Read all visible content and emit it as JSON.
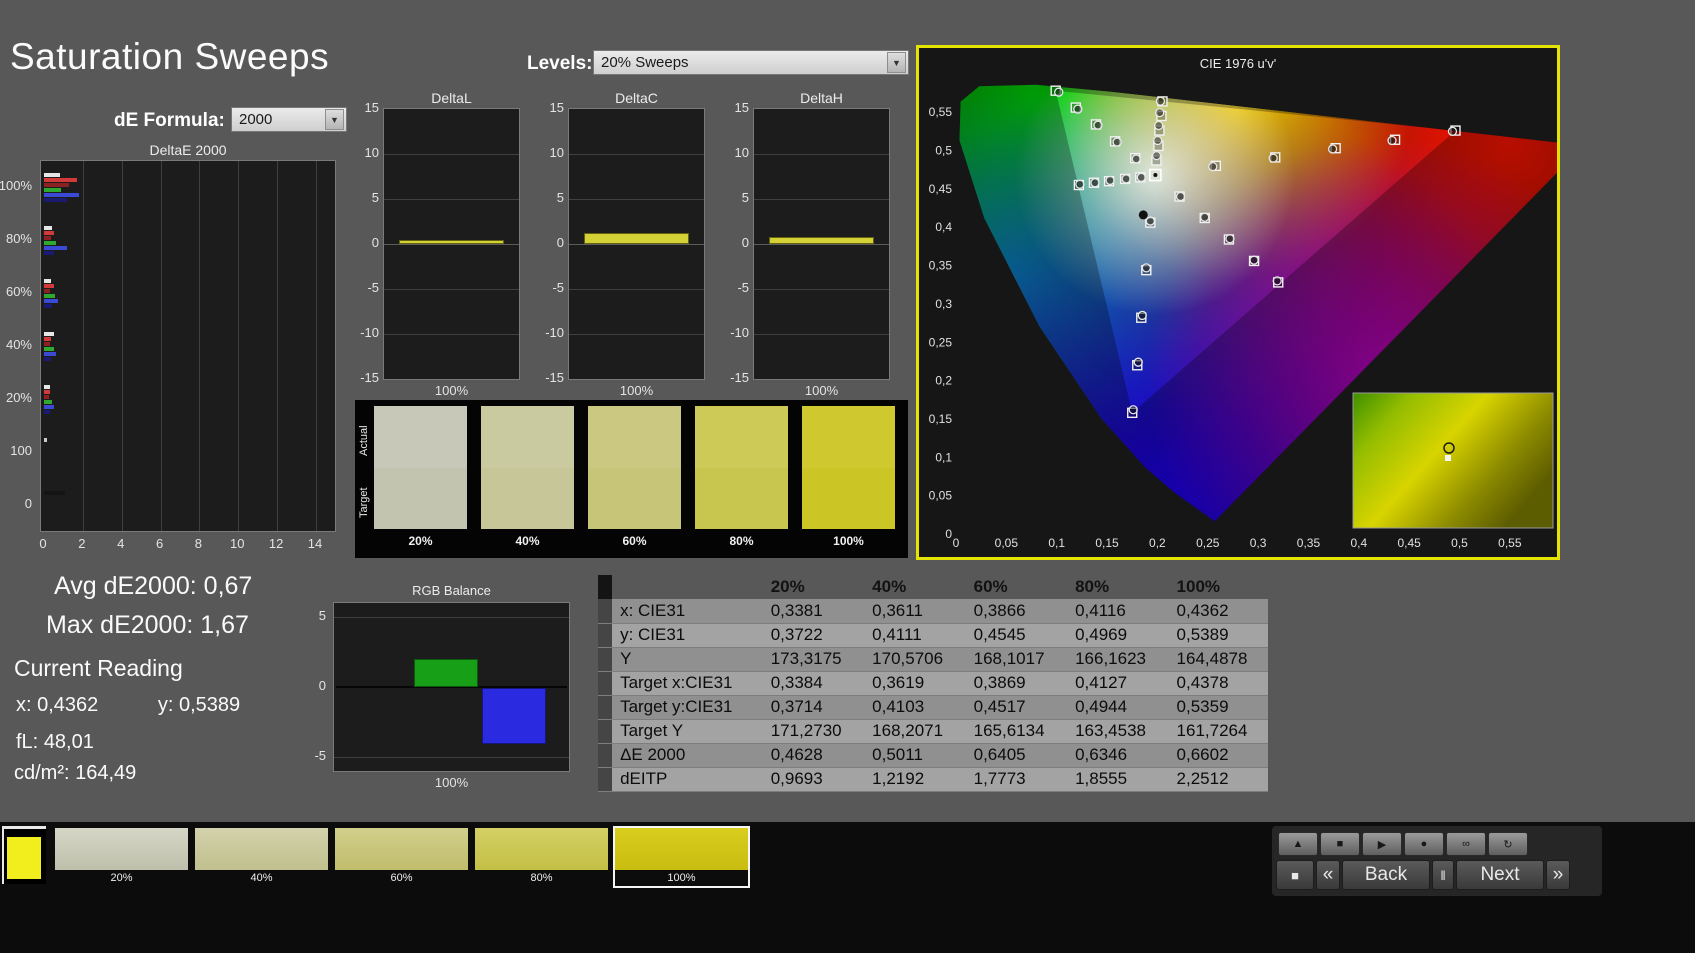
{
  "page": {
    "title": "Saturation Sweeps"
  },
  "controls": {
    "de_formula_label": "dE Formula:",
    "de_formula_value": "2000",
    "levels_label": "Levels:",
    "levels_value": "20% Sweeps"
  },
  "delta_e_chart": {
    "title": "DeltaE 2000",
    "x_ticks": [
      "0",
      "2",
      "4",
      "6",
      "8",
      "10",
      "12",
      "14"
    ],
    "x_max": 14,
    "groups": [
      {
        "label": "100%",
        "bars": [
          {
            "c": "#e6e6e6",
            "v": 0.8
          },
          {
            "c": "#d23a3a",
            "v": 1.7
          },
          {
            "c": "#8d2020",
            "v": 1.3
          },
          {
            "c": "#2fa82f",
            "v": 0.9
          },
          {
            "c": "#3a4ad4",
            "v": 1.8
          },
          {
            "c": "#1a1a70",
            "v": 1.2
          }
        ]
      },
      {
        "label": "80%",
        "bars": [
          {
            "c": "#e6e6e6",
            "v": 0.4
          },
          {
            "c": "#d23a3a",
            "v": 0.5
          },
          {
            "c": "#8d2020",
            "v": 0.35
          },
          {
            "c": "#2fa82f",
            "v": 0.6
          },
          {
            "c": "#3a4ad4",
            "v": 1.2
          },
          {
            "c": "#1a1a70",
            "v": 0.5
          }
        ]
      },
      {
        "label": "60%",
        "bars": [
          {
            "c": "#e6e6e6",
            "v": 0.35
          },
          {
            "c": "#d23a3a",
            "v": 0.5
          },
          {
            "c": "#8d2020",
            "v": 0.3
          },
          {
            "c": "#2fa82f",
            "v": 0.55
          },
          {
            "c": "#3a4ad4",
            "v": 0.7
          },
          {
            "c": "#1a1a70",
            "v": 0.4
          }
        ]
      },
      {
        "label": "40%",
        "bars": [
          {
            "c": "#e6e6e6",
            "v": 0.5
          },
          {
            "c": "#d23a3a",
            "v": 0.35
          },
          {
            "c": "#8d2020",
            "v": 0.3
          },
          {
            "c": "#2fa82f",
            "v": 0.5
          },
          {
            "c": "#3a4ad4",
            "v": 0.6
          },
          {
            "c": "#1a1a70",
            "v": 0.35
          }
        ]
      },
      {
        "label": "20%",
        "bars": [
          {
            "c": "#e6e6e6",
            "v": 0.3
          },
          {
            "c": "#d23a3a",
            "v": 0.3
          },
          {
            "c": "#8d2020",
            "v": 0.25
          },
          {
            "c": "#2fa82f",
            "v": 0.4
          },
          {
            "c": "#3a4ad4",
            "v": 0.5
          },
          {
            "c": "#1a1a70",
            "v": 0.3
          }
        ]
      },
      {
        "label": "100",
        "bars": [
          {
            "c": "#c8c8c8",
            "v": 0.15
          }
        ]
      },
      {
        "label": "0",
        "bars": [
          {
            "c": "#141414",
            "v": 1.1
          }
        ]
      }
    ]
  },
  "delta_chart_axis": {
    "min": -15,
    "max": 15,
    "ticks": [
      15,
      10,
      5,
      0,
      -5,
      -10,
      -15
    ],
    "x_label": "100%"
  },
  "delta_charts": [
    {
      "title": "DeltaL",
      "value": 0.5
    },
    {
      "title": "DeltaC",
      "value": 1.2
    },
    {
      "title": "DeltaH",
      "value": 0.8
    }
  ],
  "swatch_panel": {
    "row_labels": [
      "Actual",
      "Target"
    ],
    "swatches": [
      {
        "label": "20%",
        "actual": "#c7c8b8",
        "target": "#c3c4b0"
      },
      {
        "label": "40%",
        "actual": "#cacaa0",
        "target": "#c6c698"
      },
      {
        "label": "60%",
        "actual": "#cbc981",
        "target": "#c7c578"
      },
      {
        "label": "80%",
        "actual": "#cdca58",
        "target": "#c9c64f"
      },
      {
        "label": "100%",
        "actual": "#cfc92f",
        "target": "#cbc525"
      }
    ]
  },
  "cie_chart": {
    "title": "CIE 1976 u'v'",
    "border_color": "#e4e400",
    "x_ticks": [
      "0",
      "0,05",
      "0,1",
      "0,15",
      "0,2",
      "0,25",
      "0,3",
      "0,35",
      "0,4",
      "0,45",
      "0,5",
      "0,55"
    ],
    "y_ticks": [
      "0,55",
      "0,5",
      "0,45",
      "0,4",
      "0,35",
      "0,3",
      "0,25",
      "0,2",
      "0,15",
      "0,1",
      "0,05",
      "0"
    ],
    "white_point": {
      "u": 0.198,
      "v": 0.468
    },
    "targets": [
      [
        0.258,
        0.48
      ],
      [
        0.317,
        0.491
      ],
      [
        0.377,
        0.503
      ],
      [
        0.436,
        0.514
      ],
      [
        0.496,
        0.526
      ],
      [
        0.178,
        0.49
      ],
      [
        0.158,
        0.512
      ],
      [
        0.139,
        0.534
      ],
      [
        0.119,
        0.556
      ],
      [
        0.099,
        0.578
      ],
      [
        0.193,
        0.406
      ],
      [
        0.189,
        0.344
      ],
      [
        0.184,
        0.282
      ],
      [
        0.18,
        0.22
      ],
      [
        0.175,
        0.158
      ],
      [
        0.183,
        0.465
      ],
      [
        0.168,
        0.463
      ],
      [
        0.152,
        0.46
      ],
      [
        0.137,
        0.458
      ],
      [
        0.122,
        0.455
      ],
      [
        0.222,
        0.44
      ],
      [
        0.247,
        0.412
      ],
      [
        0.271,
        0.384
      ],
      [
        0.296,
        0.356
      ],
      [
        0.32,
        0.328
      ],
      [
        0.199,
        0.487
      ],
      [
        0.201,
        0.506
      ],
      [
        0.202,
        0.526
      ],
      [
        0.204,
        0.545
      ],
      [
        0.205,
        0.564
      ]
    ],
    "measured": [
      [
        0.255,
        0.479
      ],
      [
        0.315,
        0.49
      ],
      [
        0.374,
        0.502
      ],
      [
        0.433,
        0.513
      ],
      [
        0.493,
        0.525
      ],
      [
        0.179,
        0.489
      ],
      [
        0.16,
        0.511
      ],
      [
        0.141,
        0.533
      ],
      [
        0.121,
        0.554
      ],
      [
        0.102,
        0.576
      ],
      [
        0.193,
        0.408
      ],
      [
        0.189,
        0.347
      ],
      [
        0.185,
        0.285
      ],
      [
        0.181,
        0.224
      ],
      [
        0.176,
        0.162
      ],
      [
        0.184,
        0.465
      ],
      [
        0.169,
        0.463
      ],
      [
        0.153,
        0.461
      ],
      [
        0.138,
        0.458
      ],
      [
        0.123,
        0.456
      ],
      [
        0.223,
        0.44
      ],
      [
        0.247,
        0.413
      ],
      [
        0.272,
        0.385
      ],
      [
        0.296,
        0.357
      ],
      [
        0.319,
        0.33
      ],
      [
        0.1992,
        0.4933
      ],
      [
        0.2003,
        0.5131
      ],
      [
        0.2013,
        0.5326
      ],
      [
        0.2023,
        0.5494
      ],
      [
        0.203,
        0.5643
      ]
    ],
    "black_dot": [
      0.186,
      0.416
    ]
  },
  "stats": {
    "avg_label": "Avg dE2000:",
    "avg_value": "0,67",
    "max_label": "Max dE2000:",
    "max_value": "1,67",
    "current_reading": "Current Reading",
    "x_label": "x:",
    "x_value": "0,4362",
    "y_label": "y:",
    "y_value": "0,5389",
    "fl_label": "fL:",
    "fl_value": "48,01",
    "cd_label": "cd/m²:",
    "cd_value": "164,49"
  },
  "rgb_balance": {
    "title": "RGB Balance",
    "ticks": [
      5,
      0,
      -5
    ],
    "min": -6,
    "max": 6,
    "x_label": "100%",
    "series": [
      {
        "name": "red",
        "value": 0,
        "color": "#d22a2a"
      },
      {
        "name": "green",
        "value": 2,
        "color": "#17a017"
      },
      {
        "name": "blue",
        "value": -4,
        "color": "#2a2ae0"
      }
    ]
  },
  "table": {
    "header": [
      "20%",
      "40%",
      "60%",
      "80%",
      "100%"
    ],
    "rows": [
      {
        "label": "x: CIE31",
        "values": [
          "0,3381",
          "0,3611",
          "0,3866",
          "0,4116",
          "0,4362"
        ]
      },
      {
        "label": "y: CIE31",
        "values": [
          "0,3722",
          "0,4111",
          "0,4545",
          "0,4969",
          "0,5389"
        ]
      },
      {
        "label": "Y",
        "values": [
          "173,3175",
          "170,5706",
          "168,1017",
          "166,1623",
          "164,4878"
        ]
      },
      {
        "label": "Target x:CIE31",
        "values": [
          "0,3384",
          "0,3619",
          "0,3869",
          "0,4127",
          "0,4378"
        ]
      },
      {
        "label": "Target y:CIE31",
        "values": [
          "0,3714",
          "0,4103",
          "0,4517",
          "0,4944",
          "0,5359"
        ]
      },
      {
        "label": "Target Y",
        "values": [
          "171,2730",
          "168,2071",
          "165,6134",
          "163,4538",
          "161,7264"
        ]
      },
      {
        "label": "ΔE 2000",
        "values": [
          "0,4628",
          "0,5011",
          "0,6405",
          "0,6346",
          "0,6602"
        ]
      },
      {
        "label": "dEITP",
        "values": [
          "0,9693",
          "1,2192",
          "1,7773",
          "1,8555",
          "2,2512"
        ]
      }
    ]
  },
  "bottom_bar": {
    "pattern_preview_color": "#f2ee1e",
    "tiles": [
      {
        "label": "20%",
        "top": "#d5d6c6",
        "bottom": "#bfc0ab",
        "selected": false
      },
      {
        "label": "40%",
        "top": "#d3d2ab",
        "bottom": "#c1c08f",
        "selected": false
      },
      {
        "label": "60%",
        "top": "#d2cf8b",
        "bottom": "#c0bd6c",
        "selected": false
      },
      {
        "label": "80%",
        "top": "#d4d065",
        "bottom": "#c3bf45",
        "selected": false
      },
      {
        "label": "100%",
        "top": "#d9ce1e",
        "bottom": "#c8bd10",
        "selected": true
      }
    ],
    "transport": [
      {
        "name": "eject",
        "glyph": "▲"
      },
      {
        "name": "stop",
        "glyph": "■"
      },
      {
        "name": "play",
        "glyph": "▶"
      },
      {
        "name": "record",
        "glyph": "●"
      },
      {
        "name": "loop",
        "glyph": "∞"
      },
      {
        "name": "refresh",
        "glyph": "↻"
      }
    ],
    "nav": [
      {
        "name": "pattern-window",
        "label": "■"
      },
      {
        "name": "back-arrow",
        "label": "«"
      },
      {
        "name": "back",
        "label": "Back"
      },
      {
        "name": "pause",
        "label": "‖"
      },
      {
        "name": "next",
        "label": "Next"
      },
      {
        "name": "next-arrow",
        "label": "»"
      }
    ]
  }
}
